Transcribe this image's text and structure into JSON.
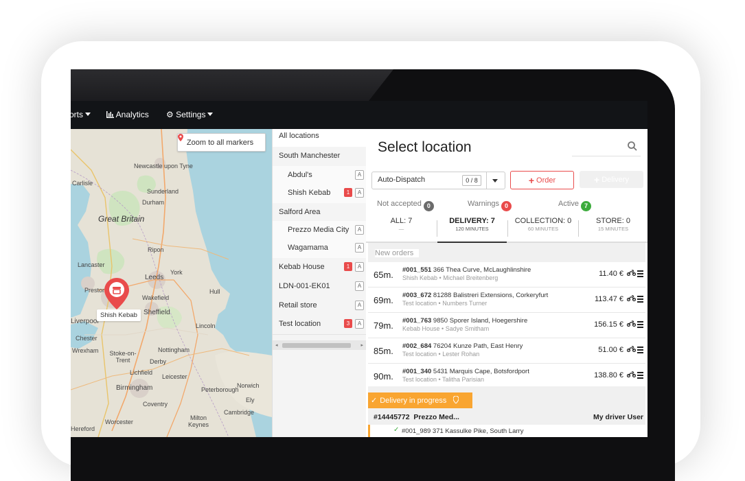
{
  "nav": {
    "items": [
      {
        "label": "orts",
        "icon": "caret-down-icon",
        "has_caret": true
      },
      {
        "label": "Analytics",
        "icon": "bar-chart-icon"
      },
      {
        "label": "Settings",
        "icon": "gear-icon",
        "has_caret": true
      }
    ]
  },
  "map": {
    "zoom_button": "Zoom to all markers",
    "marker_label": "Shish Kebab",
    "places": [
      "Newcastle upon Tyne",
      "Carlisle",
      "Sunderland",
      "Durham",
      "Great Britain",
      "Ripon",
      "York",
      "Lancaster",
      "Leeds",
      "Preston",
      "Wakefield",
      "Hull",
      "Sheffield",
      "Liverpool",
      "Lincoln",
      "Chester",
      "Wrexham",
      "Stoke-on-Trent",
      "Nottingham",
      "Derby",
      "Lichfield",
      "Leicester",
      "Norwich",
      "Birmingham",
      "Peterborough",
      "Ely",
      "Coventry",
      "Cambridge",
      "Worcester",
      "Milton Keynes",
      "Hereford"
    ]
  },
  "locations": {
    "all": "All locations",
    "items": [
      {
        "name": "South Manchester",
        "indent": false,
        "badge": null,
        "a": false
      },
      {
        "name": "Abdul's",
        "indent": true,
        "badge": null,
        "a": true
      },
      {
        "name": "Shish Kebab",
        "indent": true,
        "badge": "1",
        "a": true
      },
      {
        "name": "Salford Area",
        "indent": false,
        "badge": null,
        "a": false
      },
      {
        "name": "Prezzo Media City",
        "indent": true,
        "badge": null,
        "a": true
      },
      {
        "name": "Wagamama",
        "indent": true,
        "badge": null,
        "a": true
      },
      {
        "name": "Kebab House",
        "indent": false,
        "badge": "1",
        "a": true
      },
      {
        "name": "LDN-001-EK01",
        "indent": false,
        "badge": null,
        "a": true
      },
      {
        "name": "Retail store",
        "indent": false,
        "badge": null,
        "a": true
      },
      {
        "name": "Test location",
        "indent": false,
        "badge": "3",
        "a": true
      }
    ],
    "badge_letter": "A"
  },
  "panel": {
    "title": "Select location",
    "auto_dispatch": "Auto-Dispatch",
    "dispatch_count": "0 / 8",
    "order_button": "Order",
    "delivery_button": "Delivery",
    "stats": [
      {
        "label": "Not accepted",
        "count": "0",
        "color": "#6b6b6b"
      },
      {
        "label": "Warnings",
        "count": "0",
        "color": "#e94b4b"
      },
      {
        "label": "Active",
        "count": "7",
        "color": "#3cab3c"
      }
    ],
    "tabs": [
      {
        "label": "ALL: 7",
        "sub": "—",
        "active": false
      },
      {
        "label": "DELIVERY: 7",
        "sub": "120 MINUTES",
        "active": true
      },
      {
        "label": "COLLECTION: 0",
        "sub": "60 MINUTES",
        "active": false
      },
      {
        "label": "STORE: 0",
        "sub": "15 MINUTES",
        "active": false
      }
    ],
    "new_orders_label": "New orders",
    "orders": [
      {
        "mins": "65m.",
        "id": "#001_551",
        "address": "366 Thea Curve, McLaughlinshire",
        "store": "Shish Kebab",
        "customer": "Michael Breitenberg",
        "amount": "11.40 €"
      },
      {
        "mins": "69m.",
        "id": "#003_672",
        "address": "81288 Balistreri Extensions, Corkeryfurt",
        "store": "Test location",
        "customer": "Numbers Turner",
        "amount": "113.47 €"
      },
      {
        "mins": "79m.",
        "id": "#001_763",
        "address": "9850 Sporer Island, Hoegershire",
        "store": "Kebab House",
        "customer": "Sadye Smitham",
        "amount": "156.15 €"
      },
      {
        "mins": "85m.",
        "id": "#002_684",
        "address": "76204 Kunze Path, East Henry",
        "store": "Test location",
        "customer": "Lester Rohan",
        "amount": "51.00 €"
      },
      {
        "mins": "90m.",
        "id": "#001_340",
        "address": "5431 Marquis Cape, Botsfordport",
        "store": "Test location",
        "customer": "Talitha Parisian",
        "amount": "138.80 €"
      }
    ],
    "in_progress": {
      "label": "Delivery in progress",
      "order_id": "#14445772",
      "store": "Prezzo Med...",
      "driver": "My driver User",
      "sub_line": "#001_989  371 Kassulke Pike, South Larry"
    }
  },
  "colors": {
    "accent": "#e94b4b",
    "progress": "#f9a531",
    "nav_bg": "#121417"
  }
}
